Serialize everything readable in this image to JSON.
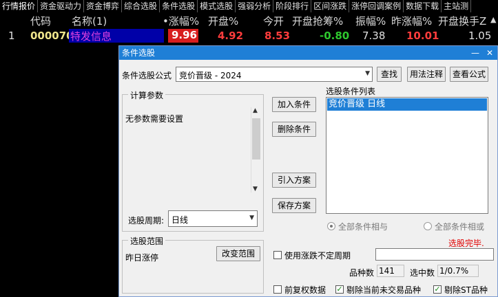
{
  "tabs": [
    "行情报价",
    "资金驱动力",
    "资金博弈",
    "综合选股",
    "条件选股",
    "模式选股",
    "强弱分析",
    "阶段排行",
    "区间涨跌",
    "涨停回调案例",
    "数据下载",
    "主站测"
  ],
  "header": {
    "code": "代码",
    "name": "名称(1)",
    "change_pct": "•涨幅%",
    "open_pct": "开盘%",
    "today_open": "今开",
    "open_grab": "开盘抢筹%",
    "amplitude": "振幅%",
    "prev_change": "昨涨幅%",
    "open_turnover": "开盘换手Z",
    "extra": "▲"
  },
  "row": {
    "index": "1",
    "code": "000070",
    "name": "特发信息",
    "change_pct": "9.96",
    "open_pct": "4.92",
    "today_open": "8.53",
    "open_grab": "-0.80",
    "amplitude": "7.38",
    "prev_change": "10.01",
    "open_turnover": "1.05"
  },
  "dialog": {
    "title": "条件选股",
    "minimize": "—",
    "close": "✕",
    "formula_label": "条件选股公式",
    "formula_value": "竞价晋级  -  2024",
    "find_button": "查找",
    "usage_button": "用法注释",
    "view_formula_button": "查看公式",
    "params_group": "计算参数",
    "params_text": "无参数需要设置",
    "add_condition": "加入条件",
    "delete_condition": "删除条件",
    "import_plan": "引入方案",
    "save_plan": "保存方案",
    "list_group": "选股条件列表",
    "list_items": [
      "竞价晋级  日线"
    ],
    "period_label": "选股周期:",
    "period_value": "日线",
    "radio_and": "全部条件相与",
    "radio_or": "全部条件相或",
    "status_text": "选股完毕.",
    "range_group": "选股范围",
    "range_value": "昨日涨停",
    "change_range": "改变范围",
    "use_period_label": "使用涨跌不定周期",
    "stock_count_label": "品种数",
    "stock_count_value": "141",
    "selected_label": "选中数",
    "selected_value": "1/0.7%",
    "pre_adjust_label": "前复权数据",
    "exclude_untraded_label": "剔除当前未交易品种",
    "exclude_st_label": "剔除ST品种"
  },
  "colors": {
    "title_bar": "#1f7fd6",
    "up_red": "#ff3c3c",
    "down_green": "#2ec82e",
    "code_yellow": "#f0e68c",
    "name_magenta": "#e040e0",
    "status_red": "#e00000"
  }
}
